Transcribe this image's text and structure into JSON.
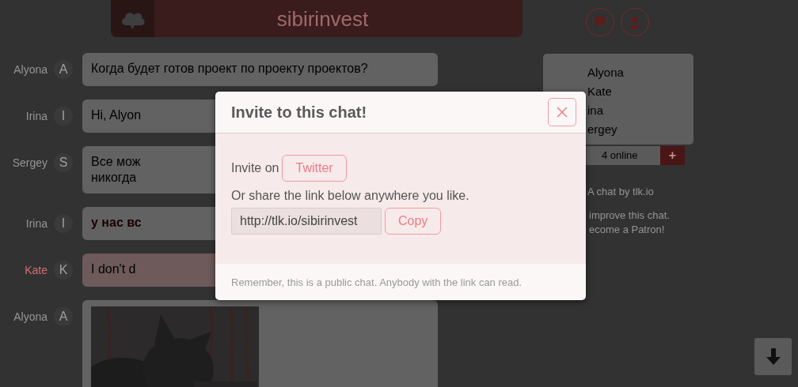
{
  "header": {
    "title": "sibirinvest"
  },
  "messages": [
    {
      "author": "Alyona",
      "initial": "A",
      "kind": "text",
      "lines": [
        "Когда будет готов проект по проекту проектов?"
      ],
      "bold": false,
      "highlighted": false
    },
    {
      "author": "Irina",
      "initial": "I",
      "kind": "text",
      "lines": [
        "Hi, Alyon"
      ],
      "bold": false,
      "highlighted": false
    },
    {
      "author": "Sergey",
      "initial": "S",
      "kind": "text",
      "lines": [
        "Все мож",
        "никогда"
      ],
      "bold": false,
      "highlighted": false
    },
    {
      "author": "Irina",
      "initial": "I",
      "kind": "text",
      "lines": [
        "у нас вс"
      ],
      "bold": true,
      "highlighted": false
    },
    {
      "author": "Kate",
      "initial": "K",
      "kind": "text",
      "lines": [
        "I don't d"
      ],
      "bold": false,
      "highlighted": true
    },
    {
      "author": "Alyona",
      "initial": "A",
      "highlighted": false
    }
  ],
  "sidebar": {
    "users": [
      "Alyona",
      "Kate",
      "ina",
      "ergey"
    ],
    "online": "4 online",
    "add_button": "+",
    "credit": "A chat by tlk.io",
    "support": [
      "improve this chat.",
      "ecome a Patron!"
    ]
  },
  "modal": {
    "title": "Invite to this chat!",
    "invite_label": "Invite on",
    "twitter_button": "Twitter",
    "share_text": "Or share the link below anywhere you like.",
    "link": "http://tlk.io/sibirinvest",
    "copy_button": "Copy",
    "note": "Remember, this is a public chat. Anybody with the link can read."
  }
}
